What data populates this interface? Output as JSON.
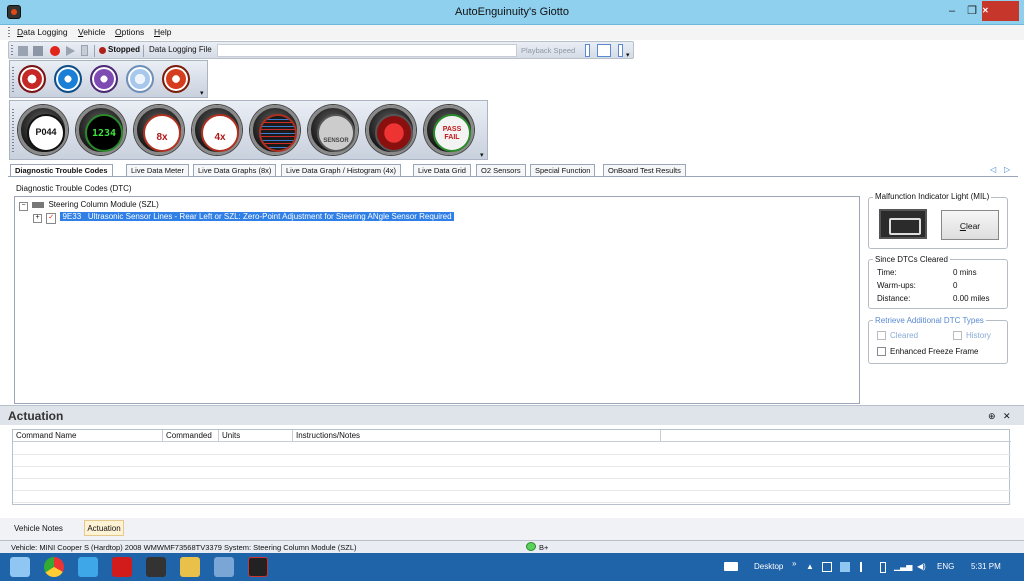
{
  "window": {
    "title": "AutoEnguinuity's Giotto",
    "minimize": "–",
    "restore": "❐",
    "close": "✕"
  },
  "menu": {
    "items": [
      {
        "u": "D",
        "rest": "ata Logging"
      },
      {
        "u": "V",
        "rest": "ehicle"
      },
      {
        "u": "O",
        "rest": "ptions"
      },
      {
        "u": "H",
        "rest": "elp"
      }
    ]
  },
  "logging": {
    "status": "Stopped",
    "file_label": "Data Logging File",
    "file_value": "",
    "playback_label": "Playback Speed"
  },
  "tools": [
    "clipboard-icon",
    "refresh-icon",
    "disconnect-icon",
    "search-icon",
    "close-icon"
  ],
  "gauges": [
    {
      "name": "dtc-gauge",
      "text": "P044"
    },
    {
      "name": "data-meter-gauge",
      "text": "1234"
    },
    {
      "name": "graphs-8x-gauge",
      "text": "8x"
    },
    {
      "name": "graph-4x-gauge",
      "text": "4x"
    },
    {
      "name": "data-grid-gauge",
      "text": ""
    },
    {
      "name": "o2-sensor-gauge",
      "text": "SENSOR"
    },
    {
      "name": "special-function-gauge",
      "text": ""
    },
    {
      "name": "onboard-test-gauge",
      "text": "PASS FAIL"
    }
  ],
  "tabs": [
    {
      "label": "Diagnostic Trouble Codes",
      "active": true
    },
    {
      "label": "Live Data Meter"
    },
    {
      "label": "Live Data Graphs (8x)"
    },
    {
      "label": "Live Data Graph / Histogram (4x)"
    },
    {
      "label": "Live Data Grid"
    },
    {
      "label": "O2 Sensors"
    },
    {
      "label": "Special Function"
    },
    {
      "label": "OnBoard Test Results"
    }
  ],
  "tab_scroll": {
    "left": "◁",
    "right": "▷"
  },
  "dtc": {
    "heading": "Diagnostic Trouble Codes (DTC)",
    "module": "Steering Column Module (SZL)",
    "code": "9E33",
    "description": "Ultrasonic Sensor Lines - Rear Left or SZL: Zero-Point Adjustment for Steering ANgle Sensor Required"
  },
  "mil": {
    "title": "Malfunction Indicator Light (MIL)",
    "clear_u": "C",
    "clear_rest": "lear"
  },
  "since": {
    "title": "Since DTCs Cleared",
    "rows": [
      {
        "label": "Time:",
        "value": "0 mins"
      },
      {
        "label": "Warm-ups:",
        "value": "0"
      },
      {
        "label": "Distance:",
        "value": "0.00 miles"
      }
    ]
  },
  "retrieve": {
    "title": "Retrieve Additional DTC Types",
    "cleared": "Cleared",
    "history": "History",
    "freeze": "Enhanced Freeze Frame"
  },
  "actuation": {
    "title": "Actuation",
    "pin": "⊕",
    "close": "✕",
    "columns": [
      "Command Name",
      "Commanded",
      "Units",
      "Instructions/Notes",
      ""
    ]
  },
  "bottom_tabs": [
    "Vehicle Notes",
    "Actuation"
  ],
  "status": {
    "vehicle": "Vehicle: MINI  Cooper S (Hardtop)  2008  WMWMF73568TV3379 System: Steering Column Module (SZL)",
    "battery": "B+"
  },
  "taskbar": {
    "desktop": "Desktop",
    "chevron": "»",
    "lang": "ENG",
    "time": "5:31 PM"
  },
  "colors": {
    "accent": "#2f7fe6",
    "titlebar": "#8fd0ee",
    "taskbar": "#1f63a8",
    "close": "#c7362b"
  }
}
